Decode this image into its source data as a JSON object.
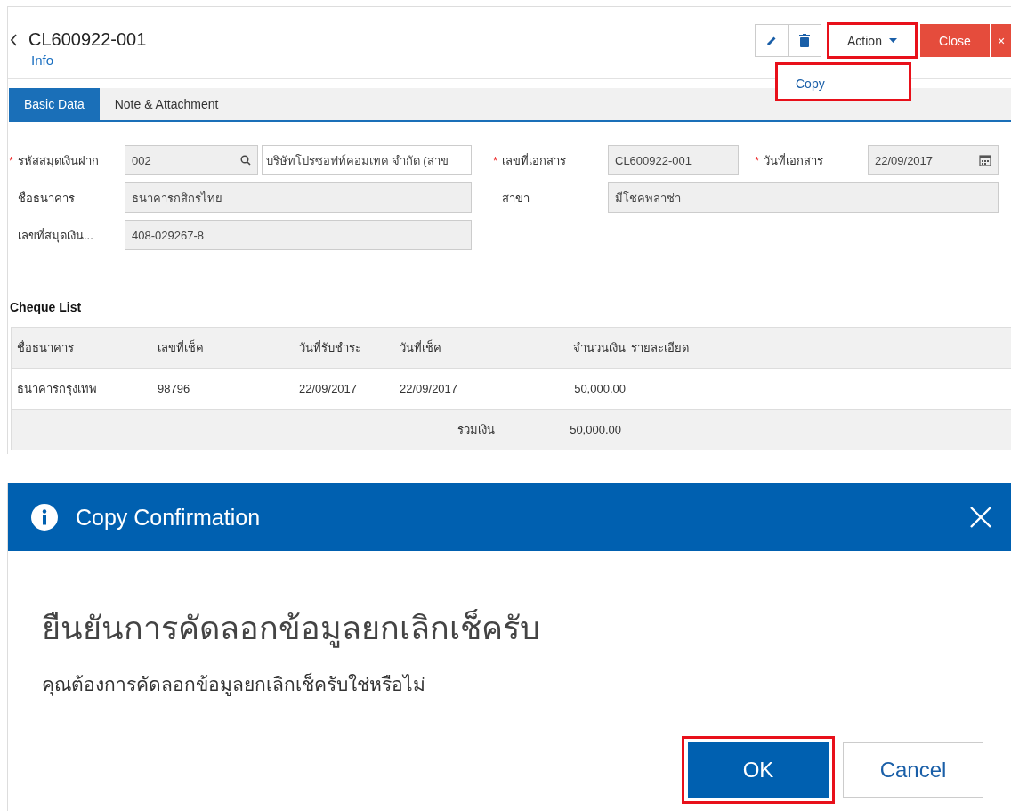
{
  "header": {
    "title": "CL600922-001",
    "subtitle": "Info",
    "action": {
      "label": "Action",
      "highlighted": true
    },
    "close": {
      "label": "Close",
      "extra": "×"
    },
    "menu": [
      {
        "label": "Copy",
        "highlighted": true
      }
    ]
  },
  "tabs": [
    {
      "label": "Basic Data",
      "selected": true
    },
    {
      "label": "Note & Attachment",
      "selected": false
    }
  ],
  "form": [
    [
      {
        "label": "รหัสสมุดเงินฝาก",
        "required_mark": "*",
        "kind": "lookup",
        "value": "002",
        "name_value": "บริษัทโปรซอฟท์คอมเทค จำกัด (สาข"
      },
      {
        "label": "เลขที่เอกสาร",
        "required_mark": "*",
        "kind": "text",
        "value": "CL600922-001"
      },
      {
        "label": "วันที่เอกสาร",
        "required_mark": "*",
        "kind": "date",
        "value": "22/09/2017"
      }
    ],
    [
      {
        "label": "ชื่อธนาคาร",
        "kind": "text",
        "value": "ธนาคารกสิกรไทย"
      },
      {
        "label": "สาขา",
        "kind": "wide",
        "value": "มีโชคพลาซ่า"
      }
    ],
    [
      {
        "label": "เลขที่สมุดเงิน...",
        "kind": "text",
        "value": "408-029267-8"
      }
    ]
  ],
  "cheque_list": {
    "title": "Cheque List",
    "columns": [
      "ชื่อธนาคาร",
      "เลขที่เช็ค",
      "วันที่รับชำระ",
      "วันที่เช็ค",
      "จำนวนเงิน",
      "รายละเอียด"
    ],
    "rows": [
      [
        "ธนาคารกรุงเทพ",
        "98796",
        "22/09/2017",
        "22/09/2017",
        "50,000.00",
        ""
      ]
    ],
    "total": {
      "label": "รวมเงิน",
      "amount": "50,000.00"
    }
  },
  "dialog": {
    "title": "Copy Confirmation",
    "heading": "ยืนยันการคัดลอกข้อมูลยกเลิกเช็ครับ",
    "message": "คุณต้องการคัดลอกข้อมูลยกเลิกเช็ครับใช่หรือไม่",
    "buttons": [
      {
        "label": "OK",
        "kind": "primary",
        "highlighted": true
      },
      {
        "label": "Cancel",
        "kind": "secondary",
        "highlighted": false
      }
    ]
  }
}
